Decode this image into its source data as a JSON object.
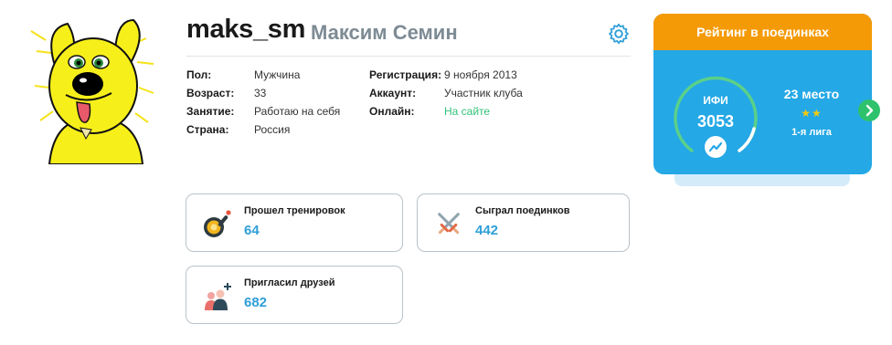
{
  "profile": {
    "username": "maks_sm",
    "real_name": "Максим Семин",
    "avatar_icon": "yellow-dog-avatar",
    "settings_icon": "gear-icon"
  },
  "details": {
    "gender_label": "Пол:",
    "gender": "Мужчина",
    "age_label": "Возраст:",
    "age": "33",
    "occupation_label": "Занятие:",
    "occupation": "Работаю на себя",
    "country_label": "Страна:",
    "country": "Россия",
    "registration_label": "Регистрация:",
    "registration": "9 ноября 2013",
    "account_label": "Аккаунт:",
    "account": "Участник клуба",
    "online_label": "Онлайн:",
    "online": "На сайте"
  },
  "stats": [
    {
      "label": "Прошел тренировок",
      "value": "64",
      "icon": "frying-pan-icon"
    },
    {
      "label": "Сыграл поединков",
      "value": "442",
      "icon": "crossed-swords-icon"
    },
    {
      "label": "Пригласил друзей",
      "value": "682",
      "icon": "invite-friends-icon"
    }
  ],
  "rating": {
    "title": "Рейтинг в поединках",
    "ifi_label": "ИФИ",
    "ifi_value": "3053",
    "place": "23 место",
    "stars": "★★",
    "league": "1-я лига",
    "trend_icon": "trend-up-icon",
    "next_icon": "chevron-right-icon"
  },
  "colors": {
    "accent_blue": "#24a8e6",
    "accent_orange": "#f59a07",
    "online_green": "#33c27a",
    "value_blue": "#2e9fd8"
  }
}
